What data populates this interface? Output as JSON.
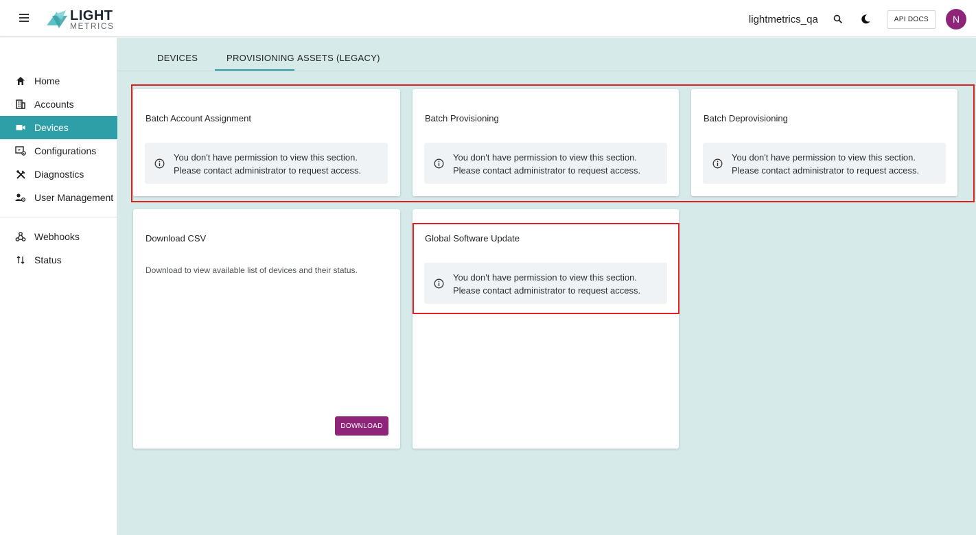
{
  "header": {
    "logo_line1": "LIGHT",
    "logo_line2": "METRICS",
    "username": "lightmetrics_qa",
    "api_docs_label": "API DOCS",
    "avatar_initial": "N",
    "icons": [
      "menu-icon",
      "search-icon",
      "dark-mode-icon"
    ]
  },
  "sidebar": {
    "items": [
      {
        "label": "Home",
        "icon": "home-icon"
      },
      {
        "label": "Accounts",
        "icon": "building-icon"
      },
      {
        "label": "Devices",
        "icon": "camera-icon",
        "active": true
      },
      {
        "label": "Configurations",
        "icon": "configurations-icon"
      },
      {
        "label": "Diagnostics",
        "icon": "tools-icon"
      },
      {
        "label": "User Management",
        "icon": "user-settings-icon"
      }
    ],
    "secondary_items": [
      {
        "label": "Webhooks",
        "icon": "webhook-icon"
      },
      {
        "label": "Status",
        "icon": "swap-arrows-icon"
      }
    ]
  },
  "tabs": [
    {
      "label": "DEVICES"
    },
    {
      "label": "PROVISIONING",
      "active": true
    },
    {
      "label": "ASSETS (LEGACY)"
    }
  ],
  "permission_notice": {
    "line1": "You don't have permission to view this section.",
    "line2": "Please contact administrator to request access."
  },
  "cards": {
    "batch_account": {
      "title": "Batch Account Assignment"
    },
    "batch_provisioning": {
      "title": "Batch Provisioning"
    },
    "batch_deprovisioning": {
      "title": "Batch Deprovisioning"
    },
    "download_csv": {
      "title": "Download CSV",
      "description": "Download to view available list of devices and their status.",
      "button_label": "DOWNLOAD"
    },
    "global_update": {
      "title": "Global Software Update"
    }
  },
  "colors": {
    "accent_teal": "#2f9fa7",
    "brand_purple": "#8e2578",
    "main_bg": "#d6eaea",
    "highlight_red": "#e0201f"
  }
}
